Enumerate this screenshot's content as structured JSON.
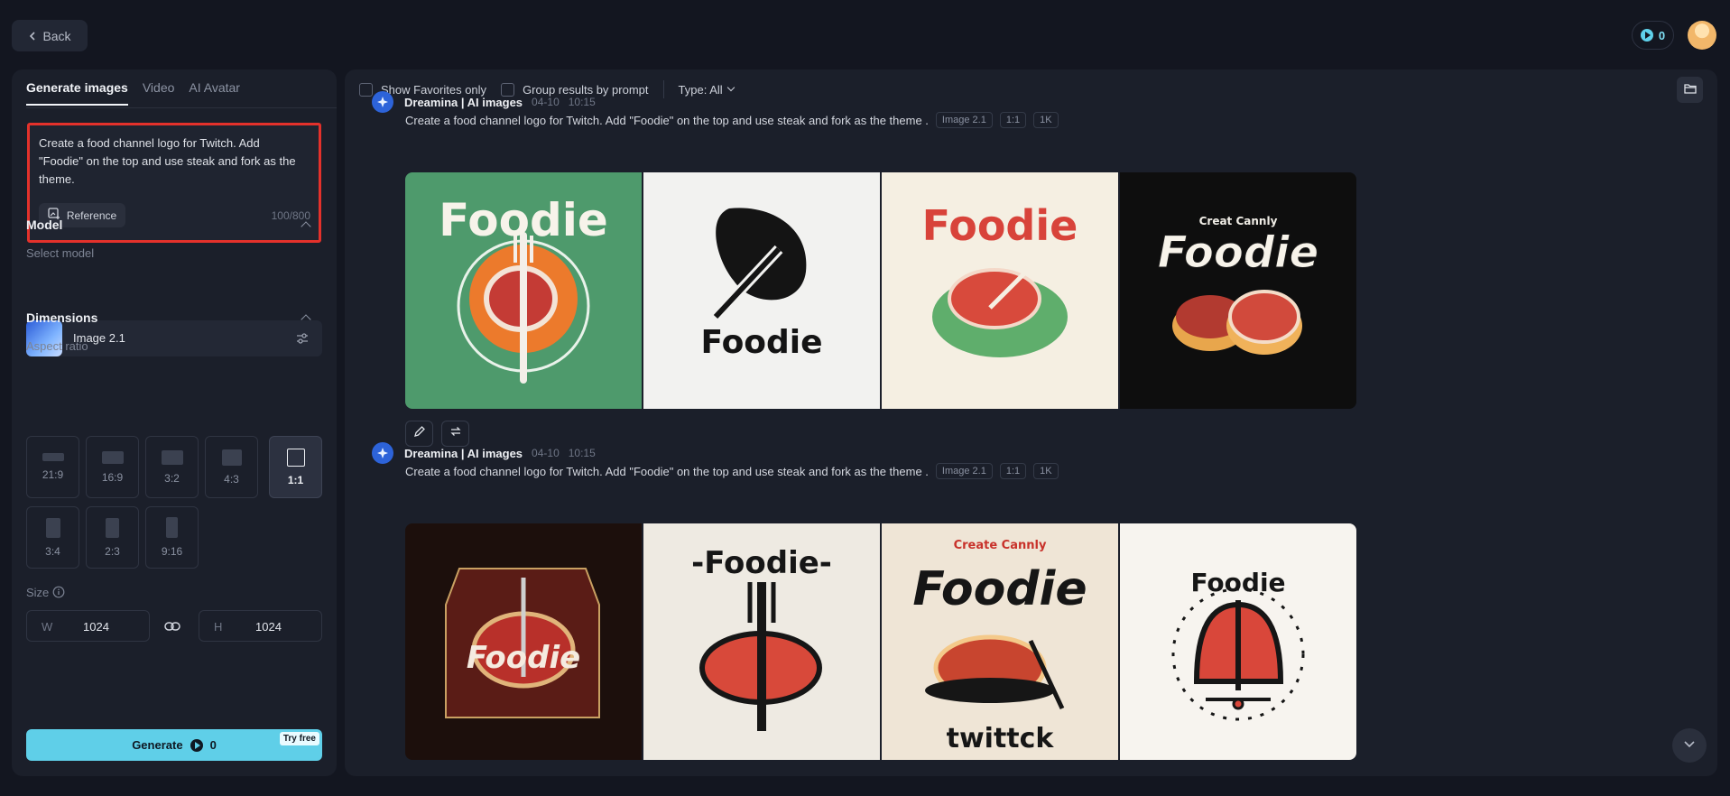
{
  "topbar": {
    "back_label": "Back",
    "credits": "0"
  },
  "sidebar": {
    "tabs": [
      {
        "label": "Generate images",
        "active": true
      },
      {
        "label": "Video",
        "active": false
      },
      {
        "label": "AI Avatar",
        "active": false
      }
    ],
    "prompt": {
      "text": "Create a food channel logo for Twitch. Add \"Foodie\" on the top and use steak and fork as the theme.",
      "char_count": "100/800",
      "reference_label": "Reference"
    },
    "model": {
      "title": "Model",
      "select_label": "Select model",
      "name": "Image 2.1"
    },
    "dimensions": {
      "title": "Dimensions",
      "aspect_label": "Aspect ratio",
      "ratios": [
        "21:9",
        "16:9",
        "3:2",
        "4:3",
        "1:1",
        "3:4",
        "2:3",
        "9:16"
      ],
      "selected_ratio": "1:1",
      "size_label": "Size",
      "width_prefix": "W",
      "width": "1024",
      "height_prefix": "H",
      "height": "1024"
    },
    "generate": {
      "label": "Generate",
      "cost": "0",
      "badge": "Try free"
    }
  },
  "main": {
    "filters": {
      "favorites": "Show Favorites only",
      "group": "Group results by prompt",
      "type": "Type: All"
    },
    "groups": [
      {
        "brand": "Dreamina | AI images",
        "date": "04-10",
        "time": "10:15",
        "prompt": "Create a food channel logo for Twitch. Add \"Foodie\" on the top and use steak and fork as the theme .",
        "tags": [
          "Image 2.1",
          "1:1",
          "1K"
        ],
        "images": [
          {
            "caption": "Foodie"
          },
          {
            "caption": "Foodie"
          },
          {
            "caption": "Foodie"
          },
          {
            "caption": "Foodie",
            "top": "Creat Cannly"
          }
        ]
      },
      {
        "brand": "Dreamina | AI images",
        "date": "04-10",
        "time": "10:15",
        "prompt": "Create a food channel logo for Twitch. Add \"Foodie\" on the top and use steak and fork as the theme .",
        "tags": [
          "Image 2.1",
          "1:1",
          "1K"
        ],
        "images": [
          {
            "caption": "Foodie"
          },
          {
            "caption": "-Foodie-"
          },
          {
            "caption": "Foodie",
            "top": "Create Cannly",
            "bottom": "twittck"
          },
          {
            "caption": "Foodie"
          }
        ]
      }
    ]
  },
  "colors": {
    "accent": "#5fcfe8",
    "highlight": "#e4312b",
    "panel": "#1b1f2a",
    "background": "#131620"
  }
}
